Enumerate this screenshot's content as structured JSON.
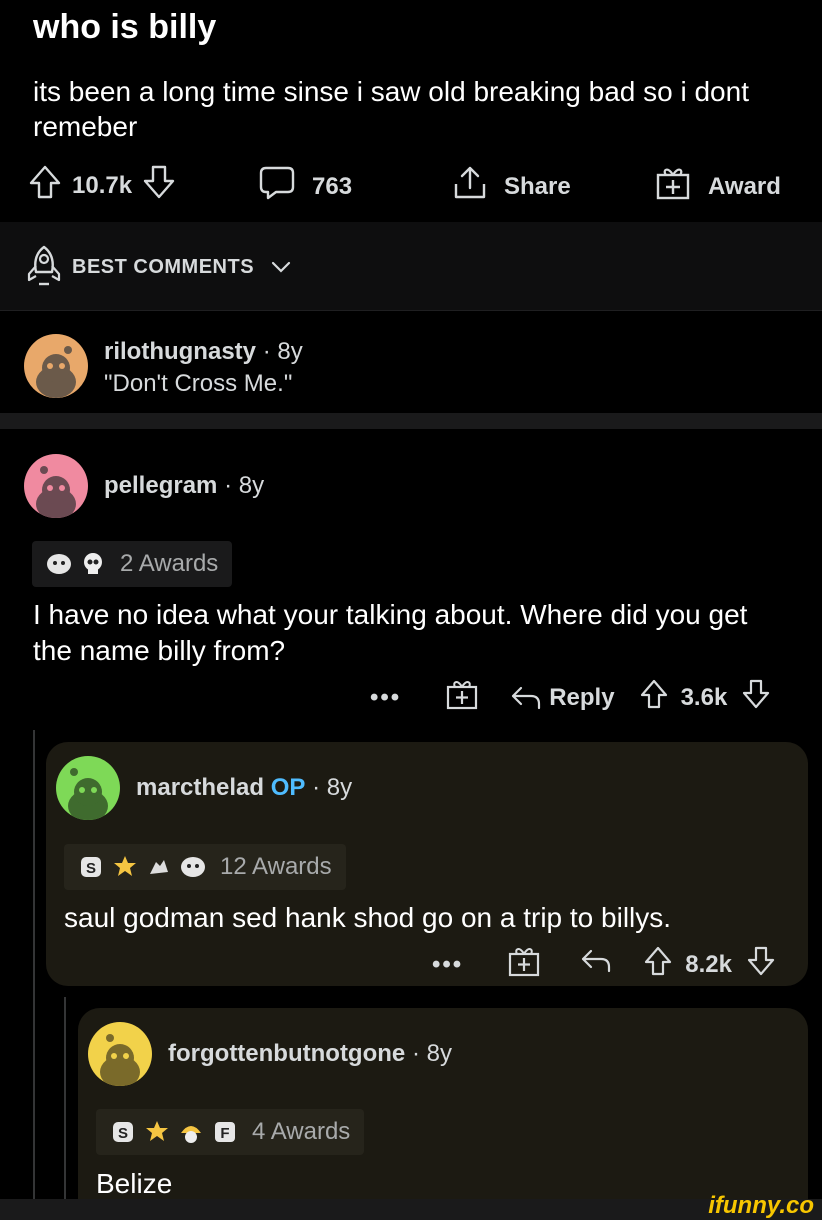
{
  "post": {
    "title": "who is billy",
    "body": "its been a long time sinse i saw old breaking bad so i dont remeber",
    "votes": "10.7k",
    "comments": "763",
    "share_label": "Share",
    "award_label": "Award"
  },
  "sort": {
    "label": "BEST COMMENTS"
  },
  "comments": [
    {
      "user": "rilothugnasty",
      "age": "· 8y",
      "text": "\"Don't Cross Me.\""
    },
    {
      "user": "pellegram",
      "age": "· 8y",
      "awards": "2 Awards",
      "text": "I have no idea what your talking about. Where did you get the name billy from?",
      "reply_label": "Reply",
      "votes": "3.6k",
      "more": "•••"
    },
    {
      "user": "marcthelad",
      "op": "OP",
      "age": "· 8y",
      "awards": "12 Awards",
      "text": "saul godman sed hank shod go on a trip to billys.",
      "votes": "8.2k",
      "more": "•••"
    },
    {
      "user": "forgottenbutnotgone",
      "age": "· 8y",
      "awards": "4 Awards",
      "text": "Belize"
    }
  ],
  "watermark": "ifunny.co",
  "colors": {
    "background": "#000000",
    "card": "#1c1a12",
    "op": "#4fbcff",
    "avatar1": "#e8a86a",
    "avatar2": "#f08aa0",
    "avatar3": "#7ed957",
    "avatar4": "#f2d24a"
  }
}
